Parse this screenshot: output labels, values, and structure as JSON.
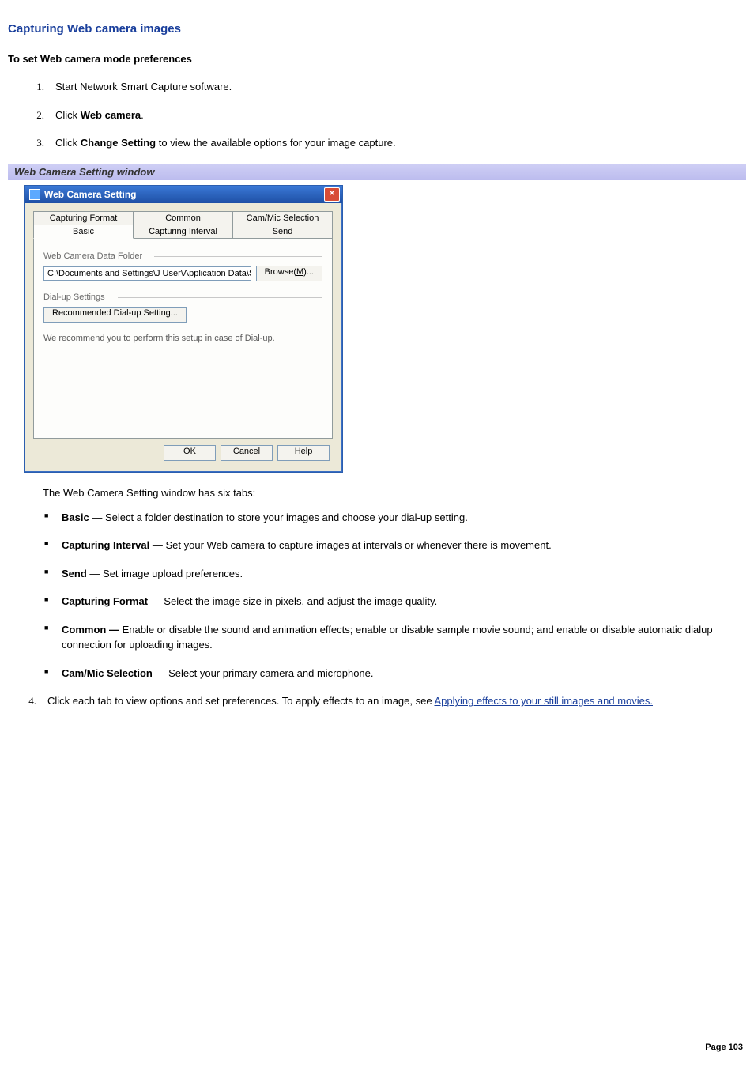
{
  "title": "Capturing Web camera images",
  "subtitle": "To set Web camera mode preferences",
  "steps": {
    "s1": {
      "num": "1.",
      "text": "Start Network Smart Capture software."
    },
    "s2": {
      "num": "2.",
      "prefix": "Click ",
      "bold": "Web camera",
      "suffix": "."
    },
    "s3": {
      "num": "3.",
      "prefix": "Click ",
      "bold": "Change Setting",
      "suffix": " to view the available options for your image capture."
    }
  },
  "caption": "Web Camera Setting window",
  "xp": {
    "title": "Web Camera Setting",
    "close": "×",
    "tabs_row1": {
      "t1": "Capturing Format",
      "t2": "Common",
      "t3": "Cam/Mic Selection"
    },
    "tabs_row2": {
      "t1": "Basic",
      "t2": "Capturing Interval",
      "t3": "Send"
    },
    "group1_label": "Web Camera Data Folder",
    "folder_value": "C:\\Documents and Settings\\J User\\Application Data\\So",
    "browse_label": "Browse(M)...",
    "group2_label": "Dial-up Settings",
    "dialup_btn": "Recommended Dial-up Setting...",
    "dialup_note": "We recommend you to perform this setup in case of Dial-up.",
    "ok": "OK",
    "cancel": "Cancel",
    "help": "Help"
  },
  "after_intro": "The Web Camera Setting window has six tabs:",
  "tabs_desc": {
    "basic": {
      "bold": "Basic",
      "sep": " — ",
      "text": "Select a folder destination to store your images and choose your dial-up setting."
    },
    "capint": {
      "bold": "Capturing Interval",
      "sep": " — ",
      "text": "Set your Web camera to capture images at intervals or whenever there is movement."
    },
    "send": {
      "bold": "Send",
      "sep": " — ",
      "text": "Set image upload preferences."
    },
    "capfmt": {
      "bold": "Capturing Format",
      "sep": " — ",
      "text": "Select the image size in pixels, and adjust the image quality."
    },
    "common": {
      "bold": "Common —",
      "sep": " ",
      "text": "Enable or disable the sound and animation effects; enable or disable sample movie sound; and enable or disable automatic dialup connection for uploading images."
    },
    "cammic": {
      "bold": "Cam/Mic Selection",
      "sep": " — ",
      "text": "Select your primary camera and microphone."
    }
  },
  "step4": {
    "num": "4.",
    "text_before": "Click each tab to view options and set preferences. To apply effects to an image, see ",
    "link": "Applying effects to your still images and movies."
  },
  "footer": "Page 103"
}
